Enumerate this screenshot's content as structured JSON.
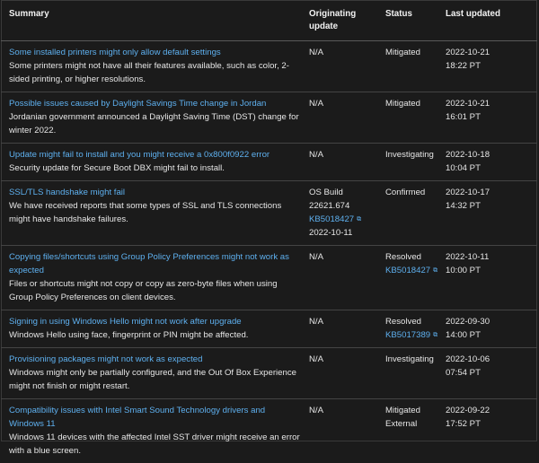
{
  "headers": {
    "summary": "Summary",
    "originating": "Originating update",
    "status": "Status",
    "last_updated": "Last updated"
  },
  "rows": [
    {
      "title": "Some installed printers might only allow default settings",
      "description": "Some printers might not have all their features available, such as color, 2-sided printing, or higher resolutions.",
      "originating": "N/A",
      "originating_link": "",
      "originating_date": "",
      "status": "Mitigated",
      "status_link": "",
      "date": "2022-10-21",
      "time": "18:22 PT"
    },
    {
      "title": "Possible issues caused by Daylight Savings Time change in Jordan",
      "description": "Jordanian government announced a Daylight Saving Time (DST) change for winter 2022.",
      "originating": "N/A",
      "originating_link": "",
      "originating_date": "",
      "status": "Mitigated",
      "status_link": "",
      "date": "2022-10-21",
      "time": "16:01 PT"
    },
    {
      "title": "Update might fail to install and you might receive a 0x800f0922 error",
      "description": "Security update for Secure Boot DBX might fail to install.",
      "originating": "N/A",
      "originating_link": "",
      "originating_date": "",
      "status": "Investigating",
      "status_link": "",
      "date": "2022-10-18",
      "time": "10:04 PT"
    },
    {
      "title": "SSL/TLS handshake might fail",
      "description": "We have received reports that some types of SSL and TLS connections might have handshake failures.",
      "originating": "OS Build 22621.674",
      "originating_link": "KB5018427",
      "originating_date": "2022-10-11",
      "status": "Confirmed",
      "status_link": "",
      "date": "2022-10-17",
      "time": "14:32 PT"
    },
    {
      "title": "Copying files/shortcuts using Group Policy Preferences might not work as expected",
      "description": "Files or shortcuts might not copy or copy as zero-byte files when using Group Policy Preferences on client devices.",
      "originating": "N/A",
      "originating_link": "",
      "originating_date": "",
      "status": "Resolved",
      "status_link": "KB5018427",
      "date": "2022-10-11",
      "time": "10:00 PT"
    },
    {
      "title": "Signing in using Windows Hello might not work after upgrade",
      "description": "Windows Hello using face, fingerprint or PIN might be affected.",
      "originating": "N/A",
      "originating_link": "",
      "originating_date": "",
      "status": "Resolved",
      "status_link": "KB5017389",
      "date": "2022-09-30",
      "time": "14:00 PT"
    },
    {
      "title": "Provisioning packages might not work as expected",
      "description": "Windows might only be partially configured, and the Out Of Box Experience might not finish or might restart.",
      "originating": "N/A",
      "originating_link": "",
      "originating_date": "",
      "status": "Investigating",
      "status_link": "",
      "date": "2022-10-06",
      "time": "07:54 PT"
    },
    {
      "title": "Compatibility issues with Intel Smart Sound Technology drivers and Windows 11",
      "description": "Windows 11 devices with the affected Intel SST driver might receive an error with a blue screen.",
      "originating": "N/A",
      "originating_link": "",
      "originating_date": "",
      "status": "Mitigated External",
      "status_link": "",
      "date": "2022-09-22",
      "time": "17:52 PT"
    }
  ]
}
